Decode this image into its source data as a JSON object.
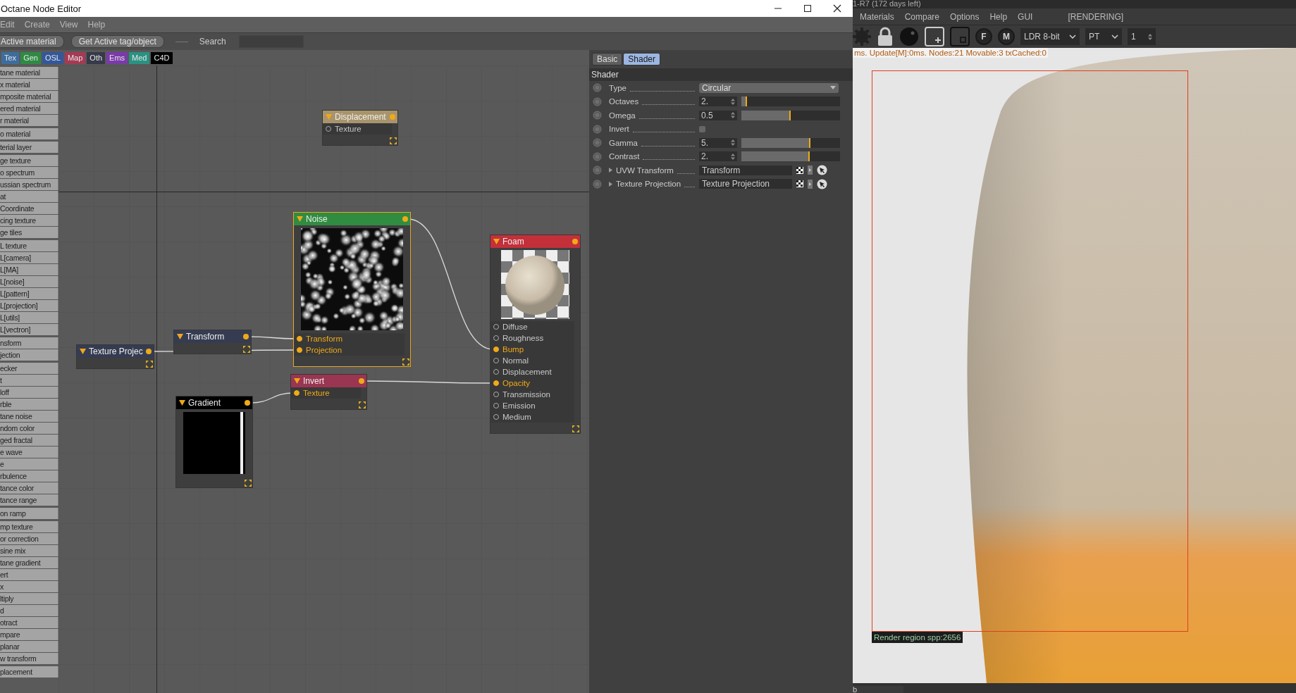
{
  "window": {
    "title": "Octane Node Editor"
  },
  "menu": [
    "Edit",
    "Create",
    "View",
    "Help"
  ],
  "toolbar": {
    "buttons": [
      "Active material",
      "Get Active tag/object"
    ],
    "search_label": "Search"
  },
  "categories": [
    {
      "label": "Tex",
      "color": "#3d6d9e"
    },
    {
      "label": "Gen",
      "color": "#2f8a44"
    },
    {
      "label": "OSL",
      "color": "#34579a"
    },
    {
      "label": "Map",
      "color": "#a53a55"
    },
    {
      "label": "Oth",
      "color": "#363a48"
    },
    {
      "label": "Ems",
      "color": "#7a3aa8"
    },
    {
      "label": "Med",
      "color": "#2a9282"
    },
    {
      "label": "C4D",
      "color": "#000000"
    }
  ],
  "sidebar": {
    "groups": [
      [
        "tane material",
        "x material",
        "mposite material",
        "ered material",
        "r material"
      ],
      [
        "o material"
      ],
      [
        "terial layer"
      ],
      [
        "ge texture",
        "o spectrum",
        "ussian spectrum",
        "at",
        "Coordinate",
        "cing texture",
        "ge tiles"
      ],
      [
        "L texture",
        "L[camera]",
        "L[MA]",
        "L[noise]",
        "L[pattern]",
        "L[projection]",
        "L[utils]",
        "L[vectron]"
      ],
      [
        "nsform",
        "jection"
      ],
      [
        "ecker",
        "t",
        "loff",
        "rble",
        "tane noise",
        "ndom color",
        "ged fractal",
        "e wave",
        "e",
        "rbulence",
        "tance color",
        "tance range"
      ],
      [
        "on ramp"
      ],
      [
        "mp texture",
        "or correction",
        "sine mix",
        "tane gradient",
        "ert",
        "x",
        "ltiply",
        "d",
        "otract",
        "mpare",
        "planar",
        "w transform"
      ],
      [
        "placement"
      ]
    ]
  },
  "nodes": [
    {
      "title": "Displacement",
      "color": "#a8946c",
      "selected": false,
      "kind": "plain",
      "inputs": [
        {
          "label": "Texture",
          "connected": false
        }
      ]
    },
    {
      "title": "Noise",
      "color": "#2f8c40",
      "selected": true,
      "kind": "noise",
      "inputs": [
        {
          "label": "Transform",
          "connected": true
        },
        {
          "label": "Projection",
          "connected": true
        }
      ]
    },
    {
      "title": "Foam",
      "color": "#c4303a",
      "selected": false,
      "kind": "sphere",
      "inputs": [
        {
          "label": "Diffuse",
          "connected": false
        },
        {
          "label": "Roughness",
          "connected": false
        },
        {
          "label": "Bump",
          "connected": true
        },
        {
          "label": "Normal",
          "connected": false
        },
        {
          "label": "Displacement",
          "connected": false
        },
        {
          "label": "Opacity",
          "connected": true
        },
        {
          "label": "Transmission",
          "connected": false
        },
        {
          "label": "Emission",
          "connected": false
        },
        {
          "label": "Medium",
          "connected": false
        }
      ]
    },
    {
      "title": "Transform",
      "color": "#353c52",
      "selected": false,
      "kind": "plain"
    },
    {
      "title": "Texture Projec",
      "color": "#353c52",
      "selected": false,
      "kind": "plain"
    },
    {
      "title": "Invert",
      "color": "#9a3552",
      "selected": false,
      "kind": "plain",
      "inputs": [
        {
          "label": "Texture",
          "connected": true
        }
      ]
    },
    {
      "title": "Gradient",
      "color": "#000000",
      "selected": false,
      "kind": "gradient"
    }
  ],
  "attributes": {
    "tabs": [
      {
        "label": "Basic",
        "selected": false
      },
      {
        "label": "Shader",
        "selected": true
      }
    ],
    "section": "Shader",
    "rows": [
      {
        "kind": "dropdown",
        "label": "Type",
        "value": "Circular"
      },
      {
        "kind": "slider",
        "label": "Octaves",
        "value": "2.",
        "level": 0.06
      },
      {
        "kind": "slider",
        "label": "Omega",
        "value": "0.5",
        "level": 0.5
      },
      {
        "kind": "checkbox",
        "label": "Invert",
        "checked": false
      },
      {
        "kind": "slider",
        "label": "Gamma",
        "value": "5.",
        "level": 0.7
      },
      {
        "kind": "slider",
        "label": "Contrast",
        "value": "2.",
        "level": 0.69
      },
      {
        "kind": "link",
        "label": "UVW Transform",
        "value": "Transform"
      },
      {
        "kind": "link",
        "label": "Texture Projection",
        "value": "Texture Projection"
      }
    ]
  },
  "render": {
    "title": "1-R7 (172 days left)",
    "menu": [
      "Materials",
      "Compare",
      "Options",
      "Help",
      "GUI"
    ],
    "status": "[RENDERING]",
    "pin_letters": [
      "F",
      "M"
    ],
    "selects": [
      "LDR 8-bit",
      "PT"
    ],
    "samples": "1",
    "stats": "ms. Update[M]:0ms. Nodes:21 Movable:3 txCached:0",
    "region_label": "Render region spp:2656",
    "bottom_tab": "b"
  }
}
